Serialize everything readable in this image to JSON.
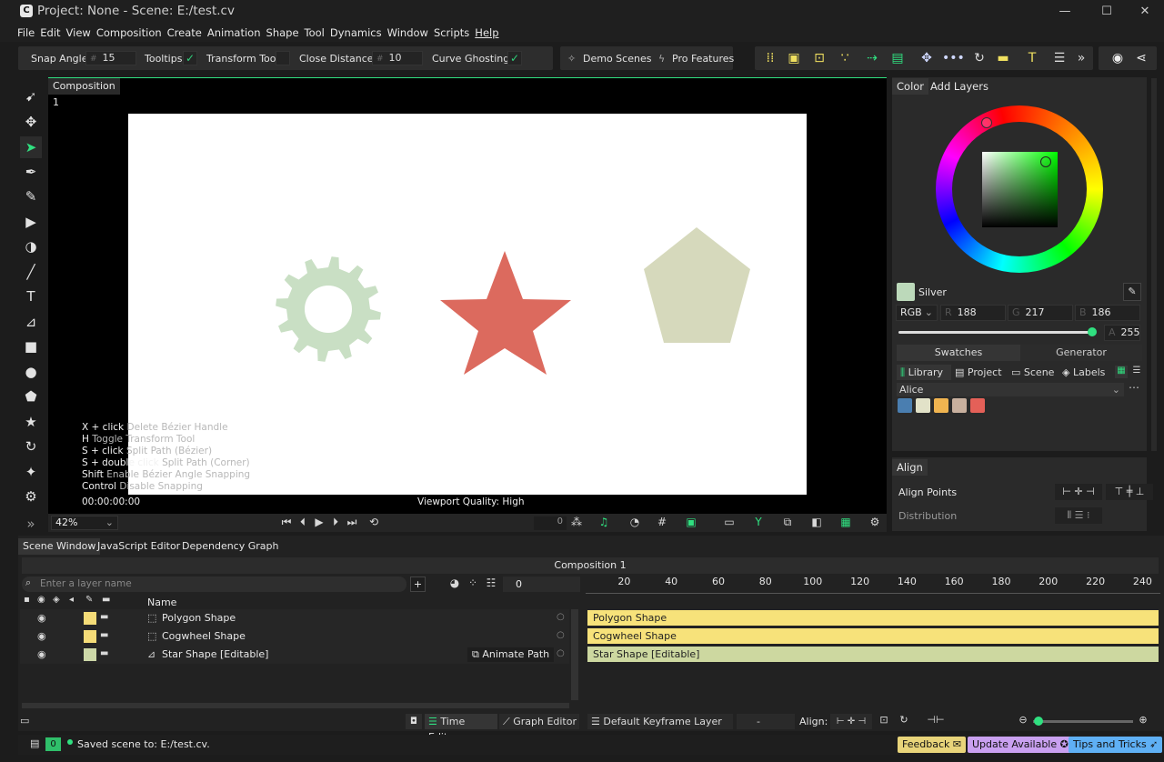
{
  "window": {
    "title": "Project: None - Scene: E:/test.cv",
    "app_icon": "C",
    "minimize": "—",
    "maximize": "☐",
    "close": "✕"
  },
  "menu": [
    "File",
    "Edit",
    "View",
    "Composition",
    "Create",
    "Animation",
    "Shape",
    "Tool",
    "Dynamics",
    "Window",
    "Scripts",
    "Help"
  ],
  "toolbar": {
    "snap_angle_label": "Snap Angle",
    "snap_angle_value": "15",
    "tooltips_label": "Tooltips",
    "transform_tool_label": "Transform Tool",
    "close_distance_label": "Close Distance:",
    "close_distance_value": "10",
    "curve_ghosting_label": "Curve Ghosting:",
    "demo_scenes": "Demo Scenes",
    "pro_features": "Pro Features"
  },
  "viewport": {
    "tab": "Composition 1",
    "timecode": "00:00:00:00",
    "quality": "Viewport Quality: High",
    "zoom": "42%",
    "frame": "0",
    "hints": [
      {
        "key": "X + click",
        "desc": "Delete Bézier Handle"
      },
      {
        "key": "H",
        "desc": "Toggle Transform Tool"
      },
      {
        "key": "S + click",
        "desc": "Split Path (Bézier)"
      },
      {
        "key": "S + double click",
        "desc": "Split Path (Corner)"
      },
      {
        "key": "Shift",
        "desc": "Enable Bézier Angle Snapping"
      },
      {
        "key": "Control",
        "desc": "Disable Snapping"
      }
    ],
    "shape_colors": {
      "gear": "#c9dfc4",
      "star": "#dc6a5e",
      "pentagon": "#d6d9bc"
    }
  },
  "color_panel": {
    "tabs": [
      "Color",
      "Add Layers"
    ],
    "color_name": "Silver",
    "mode": "RGB",
    "r_label": "R",
    "r": "188",
    "g_label": "G",
    "g": "217",
    "b_label": "B",
    "b": "186",
    "a_label": "A",
    "alpha": "255",
    "subtabs": [
      "Swatches",
      "Generator"
    ],
    "library_tabs": [
      "Library",
      "Project",
      "Scene",
      "Labels"
    ],
    "palette_name": "Alice",
    "swatches": [
      "#4a7eb0",
      "#e2e2c8",
      "#f0b450",
      "#c8b09e",
      "#e46058"
    ]
  },
  "align_panel": {
    "tab": "Align",
    "align_points": "Align Points",
    "distribution": "Distribution"
  },
  "bottom": {
    "tabs": [
      "Scene Window",
      "JavaScript Editor",
      "Dependency Graph"
    ],
    "composition": "Composition 1",
    "search_placeholder": "Enter a layer name",
    "frame_field": "0",
    "name_header": "Name",
    "layers": [
      {
        "name": "Polygon Shape",
        "swatch": "#f5dc78"
      },
      {
        "name": "Cogwheel Shape",
        "swatch": "#f5dc78"
      },
      {
        "name": "Star Shape [Editable]",
        "swatch": "#cdd8a8"
      }
    ],
    "animate_path": "Animate Path",
    "ruler": [
      "20",
      "40",
      "60",
      "80",
      "100",
      "120",
      "140",
      "160",
      "180",
      "200",
      "220",
      "240"
    ],
    "bars": [
      {
        "label": "Polygon Shape",
        "color": "#f7e27a"
      },
      {
        "label": "Cogwheel Shape",
        "color": "#f7e27a"
      },
      {
        "label": "Star Shape [Editable]",
        "color": "#cdd8a0"
      }
    ],
    "time_editor": "Time Editor",
    "graph_editor": "Graph Editor",
    "keyframe_layer": "Default Keyframe Layer",
    "keyframe_value": "-",
    "align_label": "Align:"
  },
  "status": {
    "count": "0",
    "message": "Saved scene to: E:/test.cv.",
    "feedback": "Feedback",
    "update": "Update Available",
    "tips": "Tips and Tricks"
  }
}
